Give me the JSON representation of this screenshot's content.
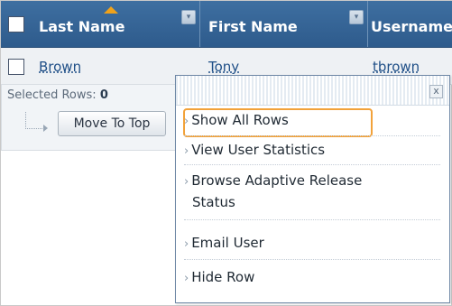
{
  "table": {
    "columns": [
      {
        "label": "Last Name"
      },
      {
        "label": "First Name"
      },
      {
        "label": "Username"
      }
    ],
    "rows": [
      {
        "last_name": "Brown",
        "first_name": "Tony",
        "username": "tbrown"
      }
    ],
    "selected_rows_label": "Selected Rows:",
    "selected_rows_count": "0",
    "move_to_top_label": "Move To Top"
  },
  "menu": {
    "close_symbol": "x",
    "items": [
      {
        "label": "Show All Rows"
      },
      {
        "label": "View User Statistics"
      },
      {
        "label": "Browse Adaptive Release"
      },
      {
        "label": "Status"
      },
      {
        "label": "Email User"
      },
      {
        "label": "Hide Row"
      }
    ],
    "chevron": "›"
  },
  "colors": {
    "header_bg": "#2e5b8c",
    "focus_ring": "#f2a23a",
    "link": "#1f4f87"
  }
}
